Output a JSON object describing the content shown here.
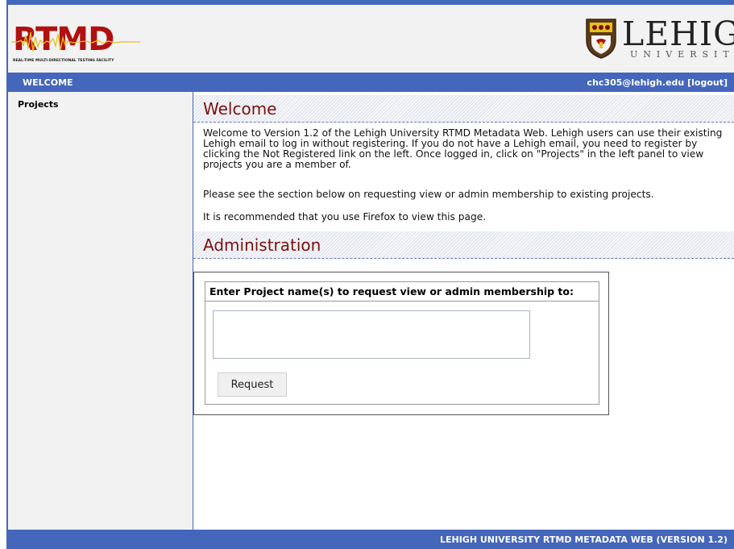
{
  "header": {
    "rtmd_logo_text": "RTMD",
    "rtmd_logo_subtitle": "REAL-TIME MULTI-DIRECTIONAL TESTING FACILITY",
    "lehigh_name": "LEHIGH",
    "lehigh_university": "UNIVERSITY"
  },
  "topbar": {
    "welcome": "WELCOME",
    "user": "chc305@lehigh.edu [logout]"
  },
  "sidebar": {
    "items": [
      {
        "label": "Projects"
      }
    ]
  },
  "main": {
    "welcome_title": "Welcome",
    "welcome_paragraph": "Welcome to Version 1.2 of the Lehigh University RTMD Metadata Web. Lehigh users can use their existing Lehigh email to log in without registering. If you do not have a Lehigh email, you need to register by clicking the Not Registered link on the left. Once logged in, click on \"Projects\" in the left panel to view projects you are a member of.",
    "membership_paragraph": "Please see the section below on requesting view or admin membership to existing projects.",
    "firefox_paragraph": "It is recommended that you use Firefox to view this page.",
    "admin_title": "Administration",
    "request_label": "Enter Project name(s) to request view or admin membership to:",
    "request_value": "",
    "request_button": "Request"
  },
  "footer": {
    "text": "LEHIGH UNIVERSITY RTMD METADATA WEB (VERSION 1.2)"
  },
  "colors": {
    "accent_blue": "#4466bb",
    "title_red": "#7a1010",
    "logo_red": "#b01010"
  }
}
